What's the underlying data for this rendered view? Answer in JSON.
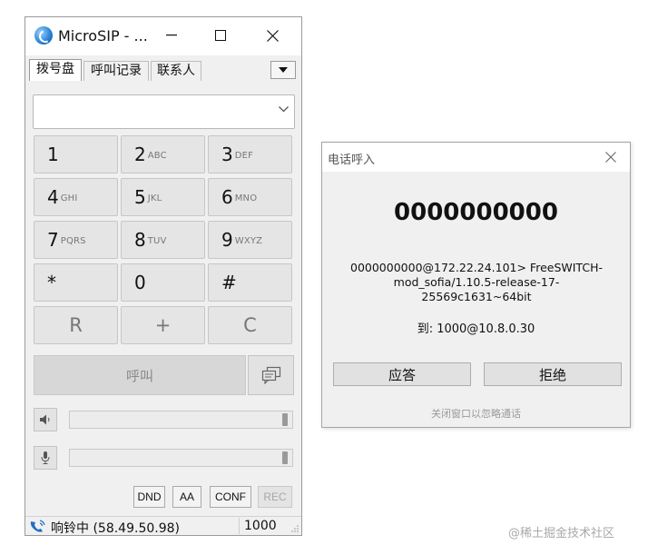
{
  "main_window": {
    "title": "MicroSIP - ...",
    "tabs": [
      "拨号盘",
      "呼叫记录",
      "联系人"
    ],
    "number_input": {
      "value": "",
      "placeholder": ""
    },
    "keypad": [
      {
        "digit": "1",
        "letters": ""
      },
      {
        "digit": "2",
        "letters": "ABC"
      },
      {
        "digit": "3",
        "letters": "DEF"
      },
      {
        "digit": "4",
        "letters": "GHI"
      },
      {
        "digit": "5",
        "letters": "JKL"
      },
      {
        "digit": "6",
        "letters": "MNO"
      },
      {
        "digit": "7",
        "letters": "PQRS"
      },
      {
        "digit": "8",
        "letters": "TUV"
      },
      {
        "digit": "9",
        "letters": "WXYZ"
      },
      {
        "digit": "*",
        "letters": ""
      },
      {
        "digit": "0",
        "letters": ""
      },
      {
        "digit": "#",
        "letters": ""
      }
    ],
    "function_keys": [
      "R",
      "+",
      "C"
    ],
    "call_label": "呼叫",
    "toggle_buttons": [
      "DND",
      "AA",
      "CONF",
      "REC"
    ],
    "status": {
      "text": "响铃中 (58.49.50.98)",
      "extension": "1000"
    }
  },
  "incoming_dialog": {
    "title": "电话呼入",
    "caller_number": "0000000000",
    "caller_uri": "0000000000@172.22.24.101> FreeSWITCH-mod_sofia/1.10.5-release-17-25569c1631~64bit",
    "callee": "到: 1000@10.8.0.30",
    "answer_label": "应答",
    "reject_label": "拒绝",
    "hint": "关闭窗口以忽略通话"
  },
  "watermark": "@稀土掘金技术社区",
  "colors": {
    "accent_blue": "#1f6fc5",
    "window_bg": "#f0f0f0",
    "key_bg": "#e5e5e5"
  }
}
